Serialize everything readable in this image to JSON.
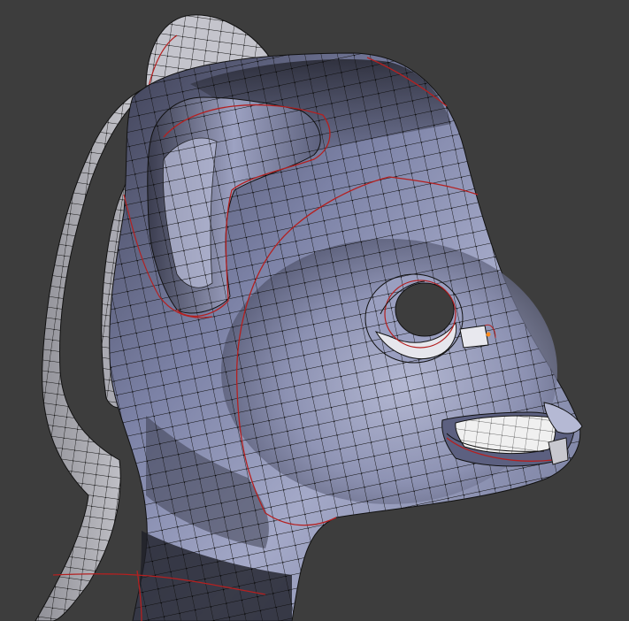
{
  "viewport": {
    "background": "#3d3d3d",
    "mode": "edit-mode-wireframe-overlay"
  },
  "mesh": {
    "subject": "cartoon-mammal-head-bust",
    "surface_color": "#8b90b2",
    "surface_shadow": "#2c2d3a",
    "surface_highlight": "#c9ccdf",
    "inner_shell_color": "#b8b8be",
    "teeth_color": "#f0f0f0",
    "edge_color": "#111111",
    "vertex_color": "#000000",
    "seam_color": "#b42020",
    "selected_vertex_color": "#ff8a1a"
  }
}
